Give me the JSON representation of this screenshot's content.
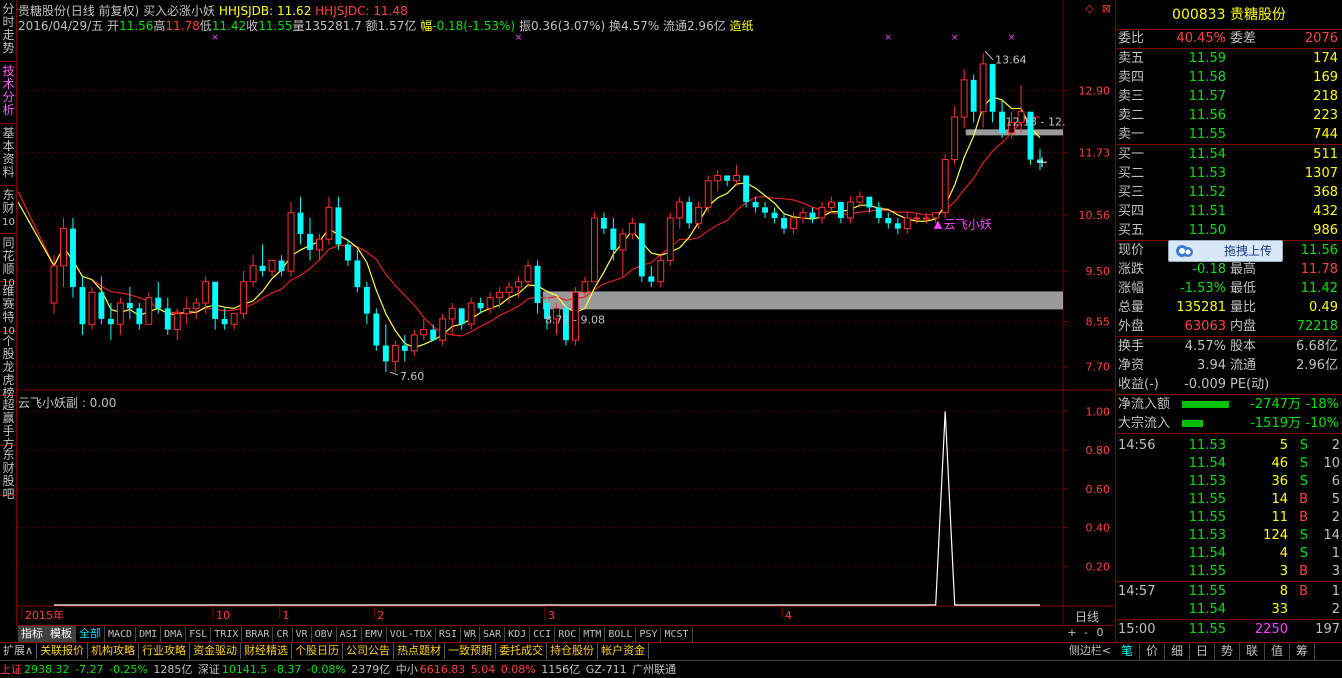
{
  "vtabs": [
    {
      "label": "分时走势",
      "sub": ""
    },
    {
      "label": "技术分析",
      "sub": ""
    },
    {
      "label": "基本资料",
      "sub": ""
    },
    {
      "label": "东财",
      "sub": "10"
    },
    {
      "label": "同花顺",
      "sub": "10"
    },
    {
      "label": "维赛特",
      "sub": "10"
    },
    {
      "label": "个股龙虎榜",
      "sub": ""
    },
    {
      "label": "超赢手方",
      "sub": ""
    },
    {
      "label": "东财股吧",
      "sub": ""
    }
  ],
  "header": {
    "stock_name": "贵糖股份",
    "mode": "(日线 前复权)",
    "indicator_name": "买入必涨小妖",
    "hhjsjdb_label": "HHJSJDB:",
    "hhjsjdb_value": "11.62",
    "hhjsjdc_label": "HHJSJDC:",
    "hhjsjdc_value": "11.48",
    "date": "2016/04/29/五",
    "open_label": "开",
    "open": "11.56",
    "high_label": "高",
    "high": "11.78",
    "low_label": "低",
    "low": "11.42",
    "close_label": "收",
    "close": "11.55",
    "vol_label": "量",
    "vol": "135281.7",
    "amount_label": "额",
    "amount": "1.57亿",
    "change_label": "幅",
    "change": "-0.18(-1.53%)",
    "amp_label": "振",
    "amp": "0.36(3.07%)",
    "turnover_label": "换",
    "turnover": "4.57%",
    "float_label": "流通",
    "float": "2.96亿",
    "concept": "造纸"
  },
  "win_buttons": [
    "◇",
    "⊠"
  ],
  "sub_title": "云飞小妖副 : 0.00",
  "chart_labels": {
    "high_mark": "13.64",
    "low_mark": "7.60",
    "range_low": "8.72 - 9.08",
    "range_high": "12.13 - 12.",
    "signal": "云飞小妖"
  },
  "chart_data": {
    "type": "candlestick",
    "title": "贵糖股份",
    "price_axis_ticks": [
      "12.90",
      "11.73",
      "10.56",
      "9.50",
      "8.55",
      "7.70"
    ],
    "sub_axis_ticks": [
      "1.00",
      "0.80",
      "0.60",
      "0.40",
      "0.20"
    ],
    "x_ticks": [
      "2015年",
      "10",
      "1",
      "2",
      "3",
      "4"
    ],
    "ohlc": [
      [
        8.9,
        9.8,
        8.7,
        9.6
      ],
      [
        9.6,
        10.5,
        9.2,
        10.3
      ],
      [
        10.3,
        10.5,
        9.0,
        9.2
      ],
      [
        9.2,
        9.4,
        8.3,
        8.5
      ],
      [
        8.5,
        9.2,
        8.4,
        9.1
      ],
      [
        9.1,
        9.4,
        8.5,
        8.6
      ],
      [
        8.6,
        8.9,
        8.2,
        8.5
      ],
      [
        8.5,
        9.0,
        8.3,
        8.9
      ],
      [
        8.9,
        9.2,
        8.6,
        8.8
      ],
      [
        8.8,
        8.9,
        8.4,
        8.5
      ],
      [
        8.5,
        9.1,
        8.5,
        9.0
      ],
      [
        9.0,
        9.3,
        8.7,
        8.8
      ],
      [
        8.8,
        9.0,
        8.3,
        8.4
      ],
      [
        8.4,
        8.8,
        8.2,
        8.7
      ],
      [
        8.7,
        9.0,
        8.5,
        8.8
      ],
      [
        8.8,
        9.0,
        8.6,
        8.9
      ],
      [
        8.9,
        9.4,
        8.7,
        9.3
      ],
      [
        9.3,
        9.2,
        8.4,
        8.6
      ],
      [
        8.6,
        8.8,
        8.4,
        8.5
      ],
      [
        8.5,
        8.7,
        8.4,
        8.7
      ],
      [
        8.7,
        9.5,
        8.6,
        9.3
      ],
      [
        9.3,
        9.8,
        9.2,
        9.6
      ],
      [
        9.6,
        10.0,
        9.4,
        9.5
      ],
      [
        9.5,
        9.7,
        9.4,
        9.7
      ],
      [
        9.7,
        9.8,
        9.4,
        9.5
      ],
      [
        9.5,
        10.8,
        9.4,
        10.6
      ],
      [
        10.6,
        10.9,
        10.0,
        10.2
      ],
      [
        10.2,
        10.5,
        9.7,
        9.9
      ],
      [
        9.9,
        10.2,
        9.7,
        10.1
      ],
      [
        10.1,
        10.9,
        10.0,
        10.7
      ],
      [
        10.7,
        10.9,
        9.9,
        10.0
      ],
      [
        10.0,
        10.1,
        9.6,
        9.7
      ],
      [
        9.7,
        9.9,
        9.1,
        9.2
      ],
      [
        9.2,
        9.3,
        8.5,
        8.7
      ],
      [
        8.7,
        8.8,
        8.0,
        8.1
      ],
      [
        8.1,
        8.5,
        7.6,
        7.8
      ],
      [
        7.8,
        8.2,
        7.6,
        8.1
      ],
      [
        8.1,
        8.3,
        7.8,
        8.0
      ],
      [
        8.0,
        8.4,
        7.9,
        8.3
      ],
      [
        8.3,
        8.6,
        8.2,
        8.4
      ],
      [
        8.4,
        8.5,
        8.2,
        8.2
      ],
      [
        8.2,
        8.7,
        8.1,
        8.6
      ],
      [
        8.6,
        8.9,
        8.3,
        8.8
      ],
      [
        8.8,
        8.7,
        8.4,
        8.5
      ],
      [
        8.5,
        9.0,
        8.4,
        8.9
      ],
      [
        8.9,
        9.0,
        8.7,
        8.8
      ],
      [
        8.8,
        9.1,
        8.7,
        9.0
      ],
      [
        9.0,
        9.2,
        8.8,
        9.1
      ],
      [
        9.1,
        9.3,
        8.9,
        9.2
      ],
      [
        9.2,
        9.4,
        9.0,
        9.3
      ],
      [
        9.3,
        9.7,
        9.2,
        9.6
      ],
      [
        9.6,
        9.7,
        8.7,
        8.9
      ],
      [
        8.9,
        9.0,
        8.4,
        8.6
      ],
      [
        8.6,
        8.9,
        8.3,
        8.8
      ],
      [
        8.8,
        8.9,
        8.1,
        8.2
      ],
      [
        8.2,
        9.2,
        8.1,
        9.1
      ],
      [
        9.1,
        9.4,
        9.0,
        9.3
      ],
      [
        9.3,
        10.6,
        9.3,
        10.5
      ],
      [
        10.5,
        10.6,
        10.2,
        10.3
      ],
      [
        10.3,
        10.5,
        9.7,
        9.9
      ],
      [
        9.9,
        10.3,
        9.4,
        10.2
      ],
      [
        10.2,
        10.5,
        10.1,
        10.4
      ],
      [
        10.4,
        10.3,
        9.3,
        9.4
      ],
      [
        9.4,
        9.6,
        9.2,
        9.3
      ],
      [
        9.3,
        9.8,
        9.2,
        9.7
      ],
      [
        9.7,
        10.6,
        9.6,
        10.5
      ],
      [
        10.5,
        10.9,
        10.3,
        10.8
      ],
      [
        10.8,
        10.9,
        10.3,
        10.4
      ],
      [
        10.4,
        10.8,
        10.3,
        10.7
      ],
      [
        10.7,
        11.3,
        10.6,
        11.2
      ],
      [
        11.2,
        11.4,
        11.0,
        11.3
      ],
      [
        11.3,
        11.3,
        11.1,
        11.2
      ],
      [
        11.2,
        11.5,
        11.1,
        11.3
      ],
      [
        11.3,
        10.9,
        10.7,
        10.8
      ],
      [
        10.8,
        10.9,
        10.6,
        10.7
      ],
      [
        10.7,
        10.8,
        10.5,
        10.6
      ],
      [
        10.6,
        10.7,
        10.4,
        10.5
      ],
      [
        10.5,
        10.6,
        10.2,
        10.3
      ],
      [
        10.3,
        10.6,
        10.2,
        10.5
      ],
      [
        10.5,
        10.7,
        10.4,
        10.6
      ],
      [
        10.6,
        10.7,
        10.4,
        10.5
      ],
      [
        10.5,
        10.8,
        10.4,
        10.7
      ],
      [
        10.7,
        10.9,
        10.6,
        10.8
      ],
      [
        10.8,
        10.8,
        10.4,
        10.5
      ],
      [
        10.5,
        10.9,
        10.4,
        10.8
      ],
      [
        10.8,
        11.0,
        10.7,
        10.9
      ],
      [
        10.9,
        10.9,
        10.6,
        10.7
      ],
      [
        10.7,
        10.8,
        10.4,
        10.5
      ],
      [
        10.5,
        10.6,
        10.3,
        10.4
      ],
      [
        10.4,
        10.5,
        10.2,
        10.3
      ],
      [
        10.3,
        10.6,
        10.2,
        10.5
      ],
      [
        10.5,
        10.6,
        10.4,
        10.5
      ],
      [
        10.5,
        10.6,
        10.4,
        10.5
      ],
      [
        10.5,
        10.6,
        10.4,
        10.6
      ],
      [
        10.6,
        11.7,
        10.5,
        11.6
      ],
      [
        11.6,
        12.6,
        11.5,
        12.4
      ],
      [
        12.4,
        13.3,
        12.2,
        13.1
      ],
      [
        13.1,
        13.2,
        12.3,
        12.5
      ],
      [
        12.5,
        13.6,
        12.2,
        13.4
      ],
      [
        13.4,
        13.1,
        12.3,
        12.5
      ],
      [
        12.5,
        12.7,
        12.0,
        12.1
      ],
      [
        12.1,
        12.5,
        12.0,
        12.3
      ],
      [
        12.3,
        13.0,
        12.1,
        12.5
      ],
      [
        12.5,
        12.4,
        11.5,
        11.6
      ],
      [
        11.6,
        11.8,
        11.4,
        11.55
      ]
    ],
    "sub_series": [
      0,
      0,
      0,
      0,
      0,
      0,
      0,
      0,
      0,
      0,
      0,
      0,
      0,
      0,
      0,
      0,
      0,
      0,
      0,
      0,
      0,
      0,
      0,
      0,
      0,
      0,
      0,
      0,
      0,
      0,
      0,
      0,
      0,
      0,
      0,
      0,
      0,
      0,
      0,
      0,
      0,
      0,
      0,
      0,
      0,
      0,
      0,
      0,
      0,
      0,
      0,
      0,
      0,
      0,
      0,
      0,
      0,
      0,
      0,
      0,
      0,
      0,
      0,
      0,
      0,
      0,
      0,
      0,
      0,
      0,
      0,
      0,
      0,
      0,
      0,
      0,
      0,
      0,
      0,
      0,
      0,
      0,
      0,
      0,
      0,
      0,
      0,
      0,
      0,
      0,
      0,
      0,
      0,
      0,
      1,
      0,
      0,
      0,
      0,
      0,
      0,
      0,
      0,
      0,
      0
    ]
  },
  "ind_tabs": [
    "指标",
    "模板",
    "全部",
    "MACD",
    "DMI",
    "DMA",
    "FSL",
    "TRIX",
    "BRAR",
    "CR",
    "VR",
    "OBV",
    "ASI",
    "EMV",
    "VOL-TDX",
    "RSI",
    "WR",
    "SAR",
    "KDJ",
    "CCI",
    "ROC",
    "MTM",
    "BOLL",
    "PSY",
    "MCST"
  ],
  "zoom_buttons": [
    "+",
    "-",
    "0"
  ],
  "day_label": "日线",
  "func_bar": [
    "扩展∧",
    "关联报价",
    "机构攻略",
    "行业攻略",
    "资金驱动",
    "财经精选",
    "个股日历",
    "公司公告",
    "热点题材",
    "一致预期",
    "委托成交",
    "持仓股份",
    "帐户资金"
  ],
  "side_btn": "侧边栏<",
  "status": {
    "sh_label": "上证",
    "sh_val": "2938.32",
    "sh_chg": "-7.27",
    "sh_pct": "-0.25%",
    "sh_amt": "1285亿",
    "sz_label": "深证",
    "sz_val": "10141.5",
    "sz_chg": "-8.37",
    "sz_pct": "-0.08%",
    "sz_amt": "2379亿",
    "zx_label": "中小",
    "zx_val": "6616.83",
    "zx_chg": "5.04",
    "zx_pct": "0.08%",
    "zx_amt": "1156亿",
    "server": "GZ-711",
    "isp": "广州联通"
  },
  "rpanel": {
    "code": "000833",
    "name": "贵糖股份",
    "webi_label": "委比",
    "webi": "40.45%",
    "weicha_label": "委差",
    "weicha": "2076",
    "sells": [
      {
        "label": "卖五",
        "price": "11.59",
        "vol": "174"
      },
      {
        "label": "卖四",
        "price": "11.58",
        "vol": "169"
      },
      {
        "label": "卖三",
        "price": "11.57",
        "vol": "218"
      },
      {
        "label": "卖二",
        "price": "11.56",
        "vol": "223"
      },
      {
        "label": "卖一",
        "price": "11.55",
        "vol": "744"
      }
    ],
    "buys": [
      {
        "label": "买一",
        "price": "11.54",
        "vol": "511"
      },
      {
        "label": "买二",
        "price": "11.53",
        "vol": "1307"
      },
      {
        "label": "买三",
        "price": "11.52",
        "vol": "368"
      },
      {
        "label": "买四",
        "price": "11.51",
        "vol": "432"
      },
      {
        "label": "买五",
        "price": "11.50",
        "vol": "986"
      }
    ],
    "upload_label": "拖拽上传",
    "stats": [
      {
        "l1": "现价",
        "v1": "",
        "l2": "",
        "v2": "11.56",
        "c2": "#00e000"
      },
      {
        "l1": "涨跌",
        "v1": "-0.18",
        "c1": "#00e000",
        "l2": "最高",
        "v2": "11.78",
        "c2": "#ff4040"
      },
      {
        "l1": "涨幅",
        "v1": "-1.53%",
        "c1": "#00e000",
        "l2": "最低",
        "v2": "11.42",
        "c2": "#00e000"
      },
      {
        "l1": "总量",
        "v1": "135281",
        "c1": "#ffff00",
        "l2": "量比",
        "v2": "0.49",
        "c2": "#ffff00"
      },
      {
        "l1": "外盘",
        "v1": "63063",
        "c1": "#ff4040",
        "l2": "内盘",
        "v2": "72218",
        "c2": "#00e000"
      }
    ],
    "stats2": [
      {
        "l1": "换手",
        "v1": "4.57%",
        "l2": "股本",
        "v2": "6.68亿"
      },
      {
        "l1": "净资",
        "v1": "3.94",
        "l2": "流通",
        "v2": "2.96亿"
      },
      {
        "l1": "收益(-)",
        "v1": "-0.009",
        "l2": "PE(动)",
        "v2": ""
      }
    ],
    "flows": [
      {
        "label": "净流入额",
        "val": "-2747万",
        "pct": "-18%",
        "bar": 0.9
      },
      {
        "label": "大宗流入",
        "val": "-1519万",
        "pct": "-10%",
        "bar": 0.4
      }
    ],
    "ticks": [
      {
        "time": "14:56",
        "price": "11.53",
        "vol": "5",
        "bs": "S",
        "n": "2"
      },
      {
        "time": "",
        "price": "11.54",
        "vol": "46",
        "bs": "S",
        "n": "10"
      },
      {
        "time": "",
        "price": "11.53",
        "vol": "36",
        "bs": "S",
        "n": "6"
      },
      {
        "time": "",
        "price": "11.55",
        "vol": "14",
        "bs": "B",
        "n": "5"
      },
      {
        "time": "",
        "price": "11.55",
        "vol": "11",
        "bs": "B",
        "n": "2"
      },
      {
        "time": "",
        "price": "11.53",
        "vol": "124",
        "bs": "S",
        "n": "14"
      },
      {
        "time": "",
        "price": "11.54",
        "vol": "4",
        "bs": "S",
        "n": "1"
      },
      {
        "time": "",
        "price": "11.55",
        "vol": "3",
        "bs": "B",
        "n": "3"
      },
      {
        "time": "14:57",
        "price": "11.55",
        "vol": "8",
        "bs": "B",
        "n": "1"
      },
      {
        "time": "",
        "price": "11.54",
        "vol": "33",
        "bs": "",
        "n": "2"
      },
      {
        "time": "15:00",
        "price": "11.55",
        "vol": "2250",
        "bs": "",
        "n": "197"
      }
    ],
    "tabs": [
      "笔",
      "价",
      "细",
      "日",
      "势",
      "联",
      "值",
      "筹"
    ]
  }
}
